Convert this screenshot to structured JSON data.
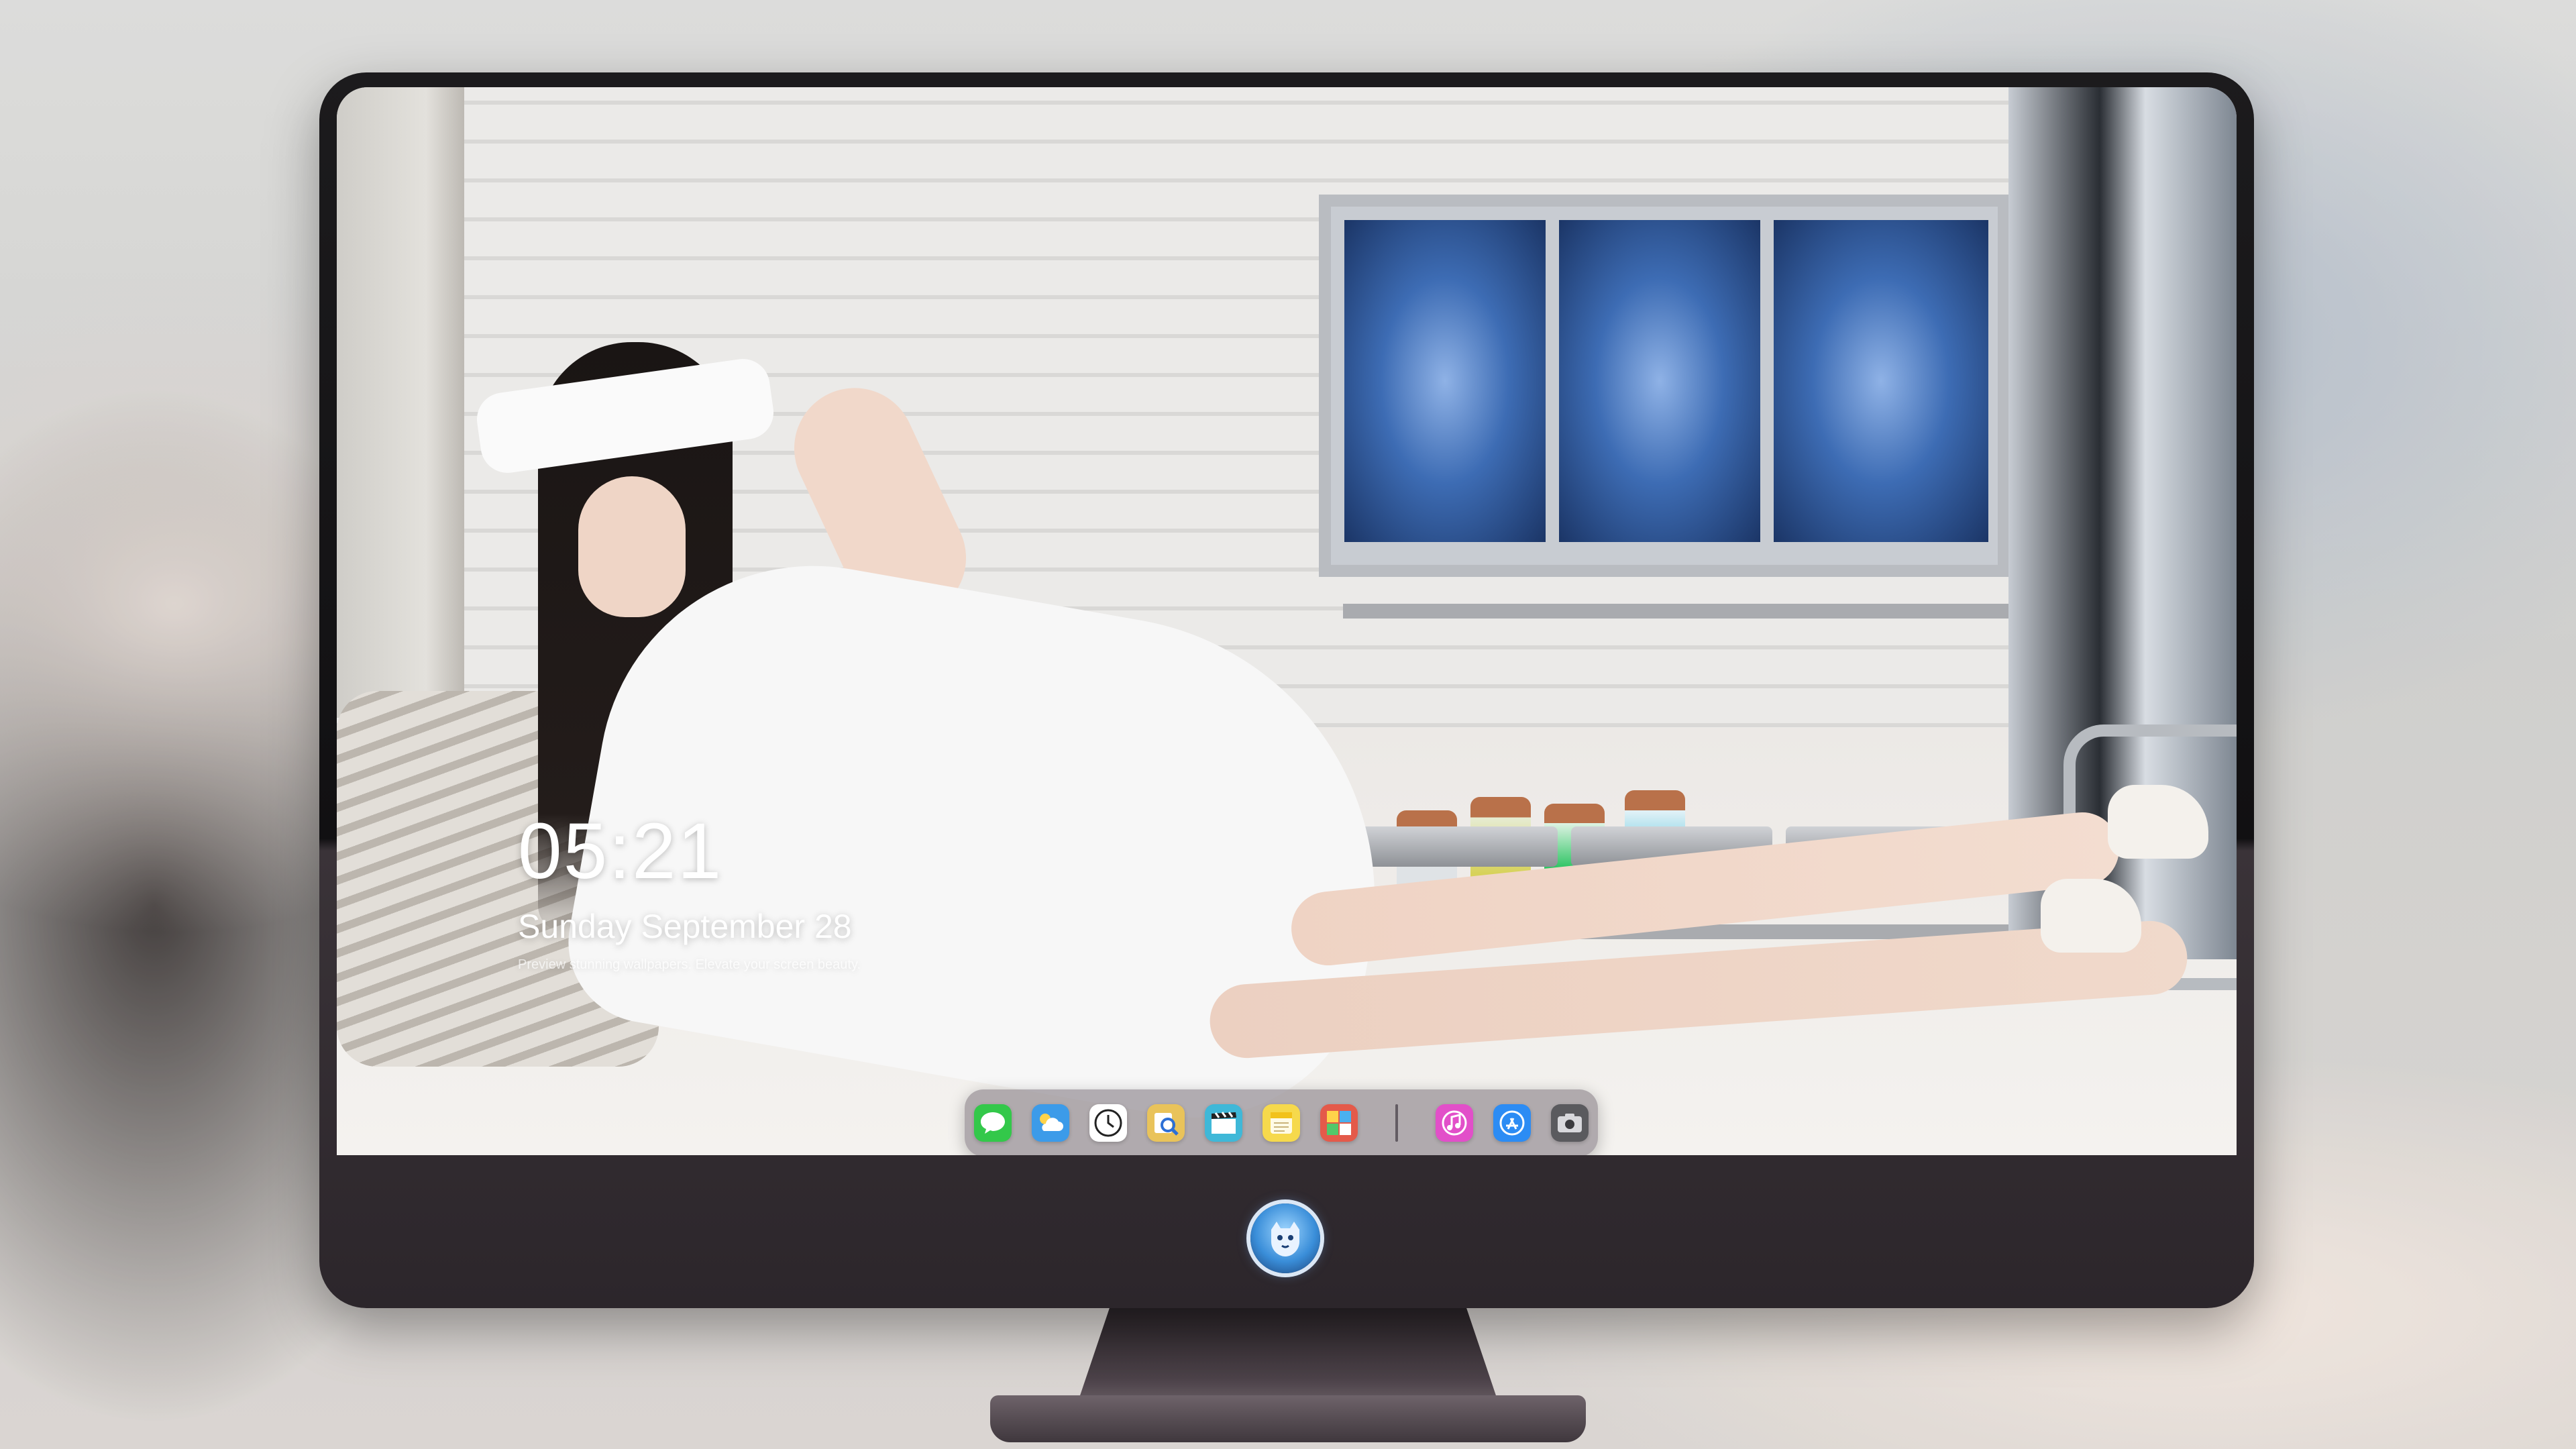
{
  "lock_screen": {
    "time": "05:21",
    "date": "Sunday September  28",
    "tagline": "Preview stunning wallpapers. Elevate your screen beauty."
  },
  "dock": {
    "apps": [
      {
        "name": "messages",
        "icon": "message-bubble-icon",
        "color": "#33c84a",
        "glyph": "💬"
      },
      {
        "name": "weather",
        "icon": "cloud-sun-icon",
        "color": "#3c9be9",
        "glyph": "⛅"
      },
      {
        "name": "clock",
        "icon": "clock-icon",
        "color": "#ffffff",
        "glyph": "🕓"
      },
      {
        "name": "preview",
        "icon": "preview-icon",
        "color": "#e9c35a",
        "glyph": "🔍"
      },
      {
        "name": "videos",
        "icon": "clapperboard-icon",
        "color": "#3fb8d8",
        "glyph": "🎬"
      },
      {
        "name": "notes",
        "icon": "notes-icon",
        "color": "#f6d94c",
        "glyph": "▤"
      },
      {
        "name": "photo-booth",
        "icon": "photo-grid-icon",
        "color": "#e45a4a",
        "glyph": "▦"
      },
      {
        "name": "music",
        "icon": "music-note-icon",
        "color": "#e24fc9",
        "glyph": "♫"
      },
      {
        "name": "app-store",
        "icon": "app-store-icon",
        "color": "#2c8cf4",
        "glyph": "Ⓐ"
      },
      {
        "name": "camera",
        "icon": "camera-icon",
        "color": "#5a5a5e",
        "glyph": "📷"
      }
    ]
  },
  "colors": {
    "bezel": "#111012",
    "chin": "#3a3338",
    "dock_background": "rgba(120,112,120,0.55)",
    "lock_text": "#ffffff"
  }
}
